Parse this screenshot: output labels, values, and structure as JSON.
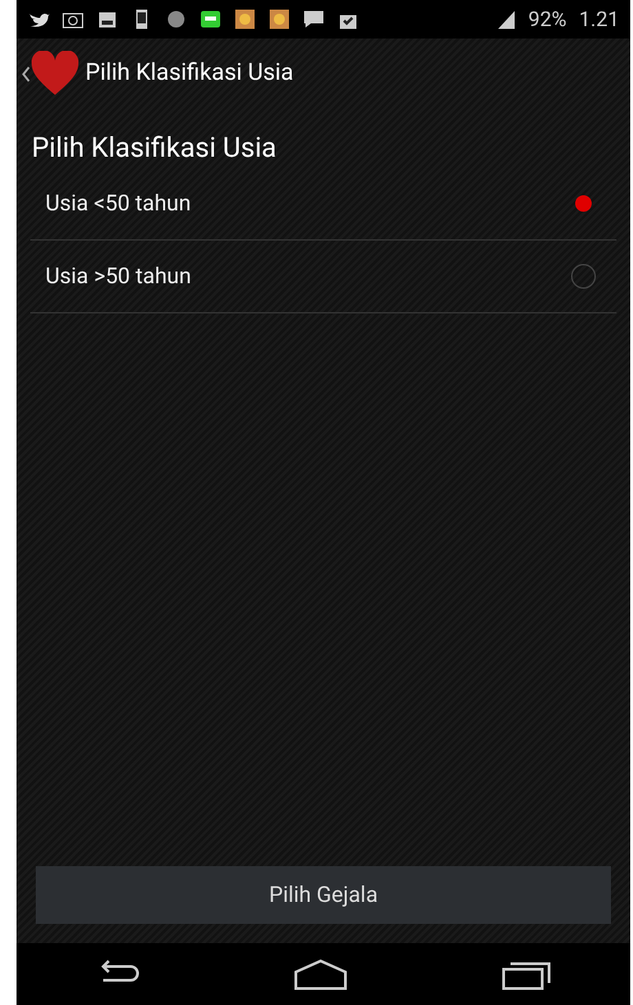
{
  "status_bar": {
    "battery": "92%",
    "time": "1.21"
  },
  "action_bar": {
    "title": "Pilih Klasifikasi Usia"
  },
  "heading": "Pilih Klasifikasi Usia",
  "options": [
    {
      "label": "Usia <50 tahun",
      "selected": true
    },
    {
      "label": "Usia >50 tahun",
      "selected": false
    }
  ],
  "button": "Pilih Gejala"
}
